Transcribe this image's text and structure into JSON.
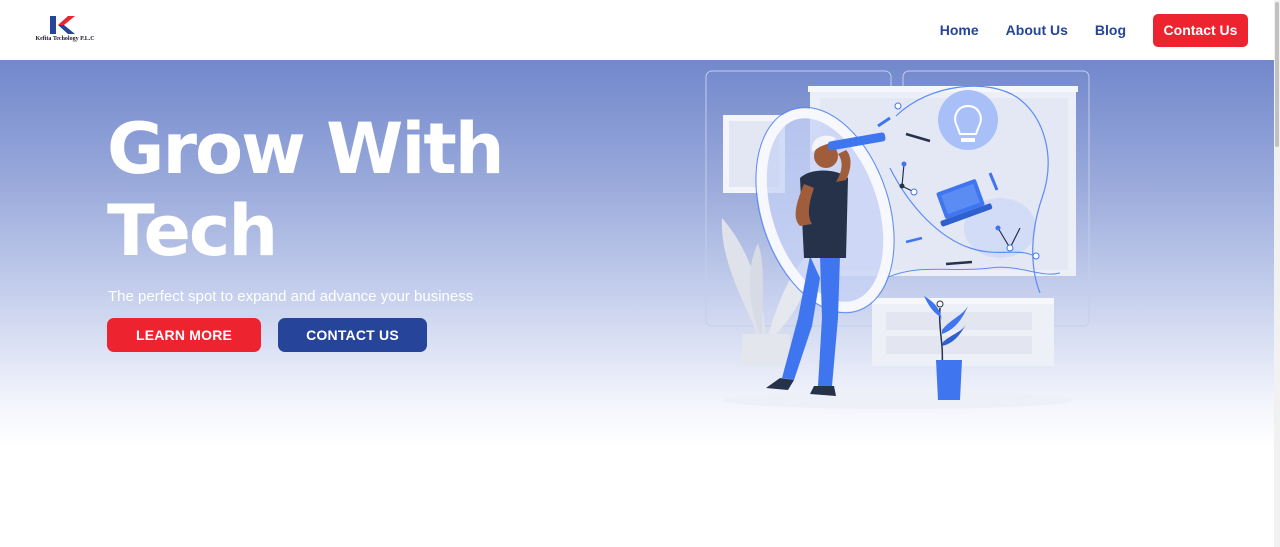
{
  "header": {
    "logo_text": "Kefita Techology P.L.C",
    "nav": {
      "home": "Home",
      "about": "About Us",
      "blog": "Blog",
      "contact": "Contact Us"
    }
  },
  "hero": {
    "title": "Grow With Tech",
    "subtitle": "The perfect spot to expand and advance your business",
    "learn_more": "LEARN MORE",
    "contact_us": "CONTACT US"
  },
  "colors": {
    "brand_red": "#ed2330",
    "brand_blue": "#25449a",
    "hero_gradient_top": "#7288cc",
    "illustration_blue": "#3f76f0"
  },
  "icons": [
    "logo-k-icon",
    "hero-illustration"
  ]
}
